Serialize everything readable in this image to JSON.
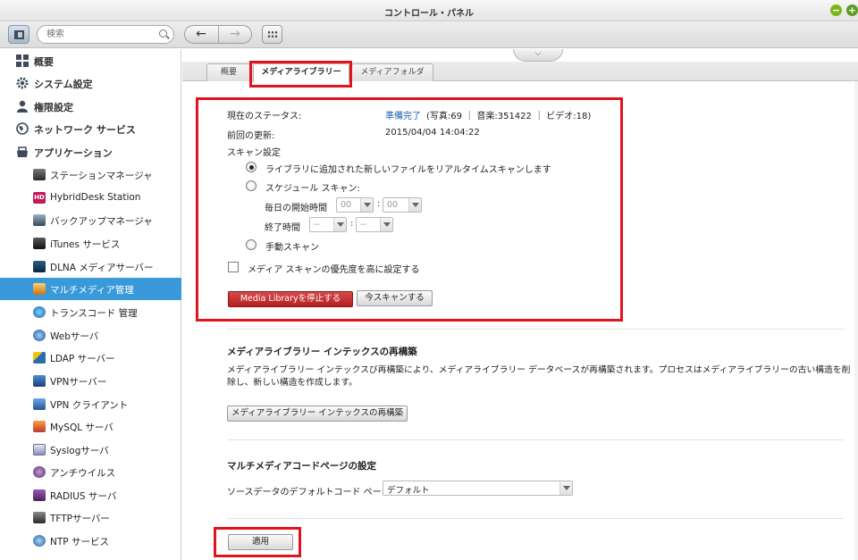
{
  "window": {
    "title": "コントロール・パネル"
  },
  "toolbar": {
    "search_placeholder": "検索"
  },
  "sidebar": {
    "categories": [
      {
        "label": "概要"
      },
      {
        "label": "システム設定"
      },
      {
        "label": "権限設定"
      },
      {
        "label": "ネットワーク サービス"
      },
      {
        "label": "アプリケーション"
      }
    ],
    "apps": [
      {
        "label": "ステーションマネージャ"
      },
      {
        "label": "HybridDesk Station"
      },
      {
        "label": "バックアップマネージャ"
      },
      {
        "label": "iTunes サービス"
      },
      {
        "label": "DLNA メディアサーバー"
      },
      {
        "label": "マルチメディア管理"
      },
      {
        "label": "トランスコード 管理"
      },
      {
        "label": "Webサーバ"
      },
      {
        "label": "LDAP サーバー"
      },
      {
        "label": "VPNサーバー"
      },
      {
        "label": "VPN クライアント"
      },
      {
        "label": "MySQL サーバ"
      },
      {
        "label": "Syslogサーバ"
      },
      {
        "label": "アンチウイルス"
      },
      {
        "label": "RADIUS サーバ"
      },
      {
        "label": "TFTPサーバー"
      },
      {
        "label": "NTP サービス"
      }
    ]
  },
  "tabs": [
    {
      "label": "概要"
    },
    {
      "label": "メディアライブラリー"
    },
    {
      "label": "メディアフォルダ"
    }
  ],
  "status": {
    "current_label": "現在のステータス:",
    "current_value": "準備完了",
    "current_detail": "(写真:69 ｜ 音楽:351422 ｜ ビデオ:18)",
    "last_update_label": "前回の更新:",
    "last_update_value": "2015/04/04 14:04:22"
  },
  "scan": {
    "title": "スキャン設定",
    "option_realtime": "ライブラリに追加された新しいファイルをリアルタイムスキャンします",
    "option_schedule": "スケジュール スキャン:",
    "start_label": "毎日の開始時間",
    "end_label": "終了時間",
    "start_hour": "00",
    "start_min": "00",
    "end_hour": "--",
    "end_min": "--",
    "colon": ":",
    "option_manual": "手動スキャン",
    "priority_label": "メディア スキャンの優先度を高に設定する",
    "stop_button": "Media Libraryを停止する",
    "scan_now_button": "今スキャンする"
  },
  "rebuild": {
    "title": "メディアライブラリー インテックスの再構築",
    "description": "メディアライブラリー インテックスび再構築により、メディアライブラリー データベースが再構築されます。プロセスはメディアライブラリーの古い構造を削除し、新しい構造を作成します。",
    "button": "メディアライブラリー インテックスの再構築"
  },
  "codepage": {
    "title": "マルチメディアコードページの設定",
    "label": "ソースデータのデフォルトコード ページ:",
    "value": "デフォルト"
  },
  "apply_button": "適用",
  "colors": {
    "accent": "#3a9ad9",
    "highlight_red": "#e0141e",
    "link": "#1a5fb4",
    "stop_button": "#c0272b"
  }
}
